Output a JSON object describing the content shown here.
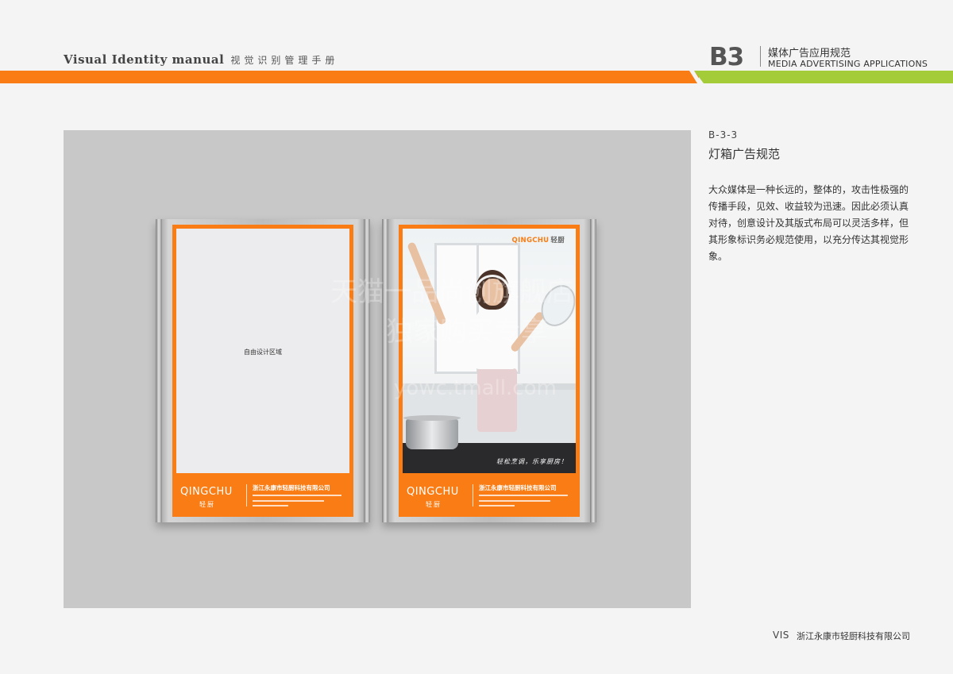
{
  "header": {
    "manual_title": "Visual Identity  manual",
    "manual_title_cn": "视觉识别管理手册",
    "section_code": "B3",
    "section_name_cn": "媒体广告应用规范",
    "section_name_en": "MEDIA ADVERTISING APPLICATIONS"
  },
  "colors": {
    "orange": "#f97c14",
    "green": "#a3cc38",
    "panel": "#c8c8c8"
  },
  "lightbox_left": {
    "free_area_label": "自由设计区域",
    "logo_text": "QINGCHU",
    "logo_cn": "轻厨",
    "company_cn": "浙江永康市轻厨科技有限公司"
  },
  "lightbox_right": {
    "brand_logo": "QINGCHU",
    "brand_cn": "轻厨",
    "slogan": "轻松烹调，乐享厨房！",
    "logo_text": "QINGCHU",
    "logo_cn": "轻厨",
    "company_cn": "浙江永康市轻厨科技有限公司"
  },
  "watermark": {
    "line1": "天猫一品尚创旗舰店",
    "line2": "独家购买专享",
    "line3": "yowc.tmall.com"
  },
  "section": {
    "code": "B-3-3",
    "title": "灯箱广告规范",
    "body": "大众媒体是一种长远的，整体的，攻击性极强的传播手段，见效、收益较为迅速。因此必须认真对待，创意设计及其版式布局可以灵活多样，但其形象标识务必规范使用，以充分传达其视觉形象。"
  },
  "footer": {
    "page": "VIS",
    "company": "浙江永康市轻厨科技有限公司"
  }
}
